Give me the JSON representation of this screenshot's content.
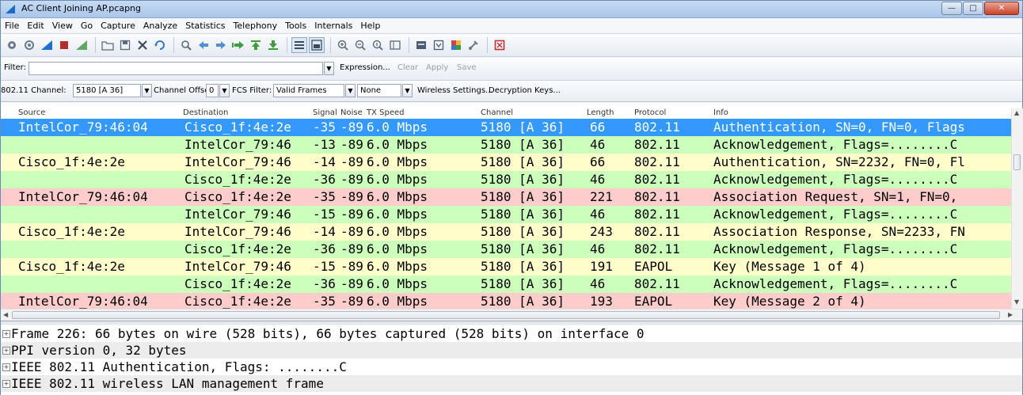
{
  "window": {
    "title": "AC Client Joining AP.pcapng"
  },
  "menu": [
    "File",
    "Edit",
    "View",
    "Go",
    "Capture",
    "Analyze",
    "Statistics",
    "Telephony",
    "Tools",
    "Internals",
    "Help"
  ],
  "filter": {
    "label": "Filter:",
    "value": "",
    "expression": "Expression...",
    "clear": "Clear",
    "apply": "Apply",
    "save": "Save"
  },
  "wireless": {
    "channel_label": "802.11 Channel:",
    "channel_value": "5180 [A 36]",
    "offset_label": "Channel Offset:",
    "offset_value": "0",
    "fcs_label": "FCS Filter:",
    "fcs_value": "Valid Frames",
    "decrypt_mode": "None",
    "settings": "Wireless Settings...",
    "keys": "Decryption Keys..."
  },
  "columns": [
    "Source",
    "Destination",
    "Signal",
    "Noise",
    "TX Speed",
    "Channel",
    "Length",
    "Protocol",
    "Info"
  ],
  "packets": [
    {
      "style": "selected",
      "source": "IntelCor_79:46:04",
      "destination": "Cisco_1f:4e:2e",
      "signal": "-35",
      "noise": "-89",
      "speed": "6.0 Mbps",
      "channel": "5180 [A 36]",
      "length": "66",
      "protocol": "802.11",
      "info": "Authentication, SN=0, FN=0, Flags"
    },
    {
      "style": "green",
      "source": "",
      "destination": "IntelCor_79:46",
      "signal": "-13",
      "noise": "-89",
      "speed": "6.0 Mbps",
      "channel": "5180 [A 36]",
      "length": "46",
      "protocol": "802.11",
      "info": "Acknowledgement, Flags=........C"
    },
    {
      "style": "yellow",
      "source": "Cisco_1f:4e:2e",
      "destination": "IntelCor_79:46",
      "signal": "-14",
      "noise": "-89",
      "speed": "6.0 Mbps",
      "channel": "5180 [A 36]",
      "length": "66",
      "protocol": "802.11",
      "info": "Authentication, SN=2232, FN=0, Fl"
    },
    {
      "style": "green",
      "source": "",
      "destination": "Cisco_1f:4e:2e",
      "signal": "-36",
      "noise": "-89",
      "speed": "6.0 Mbps",
      "channel": "5180 [A 36]",
      "length": "46",
      "protocol": "802.11",
      "info": "Acknowledgement, Flags=........C"
    },
    {
      "style": "pink",
      "source": "IntelCor_79:46:04",
      "destination": "Cisco_1f:4e:2e",
      "signal": "-35",
      "noise": "-89",
      "speed": "6.0 Mbps",
      "channel": "5180 [A 36]",
      "length": "221",
      "protocol": "802.11",
      "info": "Association Request, SN=1, FN=0,"
    },
    {
      "style": "green",
      "source": "",
      "destination": "IntelCor_79:46",
      "signal": "-15",
      "noise": "-89",
      "speed": "6.0 Mbps",
      "channel": "5180 [A 36]",
      "length": "46",
      "protocol": "802.11",
      "info": "Acknowledgement, Flags=........C"
    },
    {
      "style": "yellow",
      "source": "Cisco_1f:4e:2e",
      "destination": "IntelCor_79:46",
      "signal": "-14",
      "noise": "-89",
      "speed": "6.0 Mbps",
      "channel": "5180 [A 36]",
      "length": "243",
      "protocol": "802.11",
      "info": "Association Response, SN=2233, FN"
    },
    {
      "style": "green",
      "source": "",
      "destination": "Cisco_1f:4e:2e",
      "signal": "-36",
      "noise": "-89",
      "speed": "6.0 Mbps",
      "channel": "5180 [A 36]",
      "length": "46",
      "protocol": "802.11",
      "info": "Acknowledgement, Flags=........C"
    },
    {
      "style": "yellow",
      "source": "Cisco_1f:4e:2e",
      "destination": "IntelCor_79:46",
      "signal": "-15",
      "noise": "-89",
      "speed": "6.0 Mbps",
      "channel": "5180 [A 36]",
      "length": "191",
      "protocol": "EAPOL",
      "info": "Key (Message 1 of 4)"
    },
    {
      "style": "green",
      "source": "",
      "destination": "Cisco_1f:4e:2e",
      "signal": "-36",
      "noise": "-89",
      "speed": "6.0 Mbps",
      "channel": "5180 [A 36]",
      "length": "46",
      "protocol": "802.11",
      "info": "Acknowledgement, Flags=........C"
    },
    {
      "style": "pink",
      "source": "IntelCor_79:46:04",
      "destination": "Cisco_1f:4e:2e",
      "signal": "-35",
      "noise": "-89",
      "speed": "6.0 Mbps",
      "channel": "5180 [A 36]",
      "length": "193",
      "protocol": "EAPOL",
      "info": "Key (Message 2 of 4)"
    }
  ],
  "details": [
    "Frame 226: 66 bytes on wire (528 bits), 66 bytes captured (528 bits) on interface 0",
    "PPI version 0, 32 bytes",
    "IEEE 802.11 Authentication, Flags: ........C",
    "IEEE 802.11 wireless LAN management frame"
  ],
  "icons": [
    "interface-list-icon",
    "capture-options-icon",
    "start-capture-icon",
    "stop-capture-icon",
    "restart-capture-icon",
    "open-file-icon",
    "save-file-icon",
    "close-file-icon",
    "reload-icon",
    "find-packet-icon",
    "go-back-icon",
    "go-forward-icon",
    "go-to-packet-icon",
    "go-first-icon",
    "go-last-icon",
    "colorize-icon",
    "auto-scroll-icon",
    "zoom-in-icon",
    "zoom-out-icon",
    "zoom-normal-icon",
    "resize-columns-icon",
    "capture-filters-icon",
    "display-filters-icon",
    "coloring-rules-icon",
    "preferences-icon",
    "help-icon"
  ]
}
